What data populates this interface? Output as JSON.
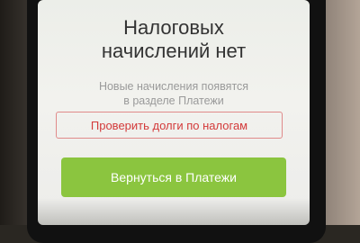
{
  "screen": {
    "title_line1": "Налоговых",
    "title_line2": "начислений нет",
    "subtitle_line1": "Новые начисления появятся",
    "subtitle_line2": "в разделе Платежи",
    "check_debts_label": "Проверить долги по налогам",
    "back_button_label": "Вернуться в Платежи"
  },
  "colors": {
    "accent_green": "#8bc53f",
    "danger_red": "#d33a3a"
  }
}
